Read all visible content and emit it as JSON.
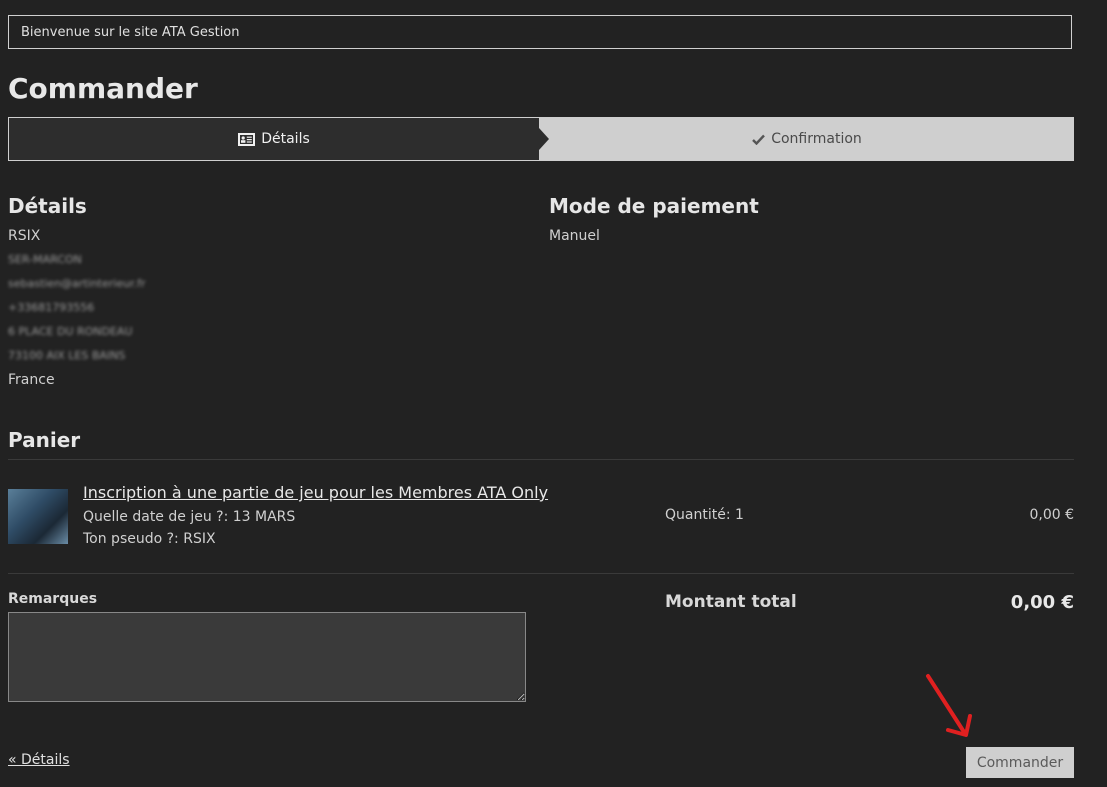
{
  "banner": {
    "text": "Bienvenue sur le site ATA Gestion"
  },
  "page": {
    "title": "Commander"
  },
  "steps": [
    {
      "label": "Détails",
      "icon": "id-card-icon",
      "state": "active"
    },
    {
      "label": "Confirmation",
      "icon": "checkmark-icon",
      "state": "next"
    }
  ],
  "details": {
    "title": "Détails",
    "name": "RSIX",
    "blurred_lines": [
      "SER-MARCON",
      "sebastien@artinterieur.fr",
      "+33681793556",
      "6 PLACE DU RONDEAU",
      "73100 AIX LES BAINS"
    ],
    "country": "France"
  },
  "payment": {
    "title": "Mode de paiement",
    "value": "Manuel"
  },
  "cart": {
    "title": "Panier",
    "items": [
      {
        "name": "Inscription à une partie de jeu pour les Membres ATA Only",
        "option1": "Quelle date de jeu ?: 13 MARS",
        "option2": "Ton pseudo ?: RSIX",
        "quantity": "Quantité: 1",
        "price": "0,00 €"
      }
    ]
  },
  "remarks": {
    "label": "Remarques",
    "value": ""
  },
  "total": {
    "label": "Montant total",
    "value": "0,00 €"
  },
  "nav": {
    "back_label": "« Détails",
    "order_label": "Commander"
  },
  "colors": {
    "background": "#222222",
    "accent_arrow": "#e02020",
    "button_bg": "#cfcfcf"
  }
}
